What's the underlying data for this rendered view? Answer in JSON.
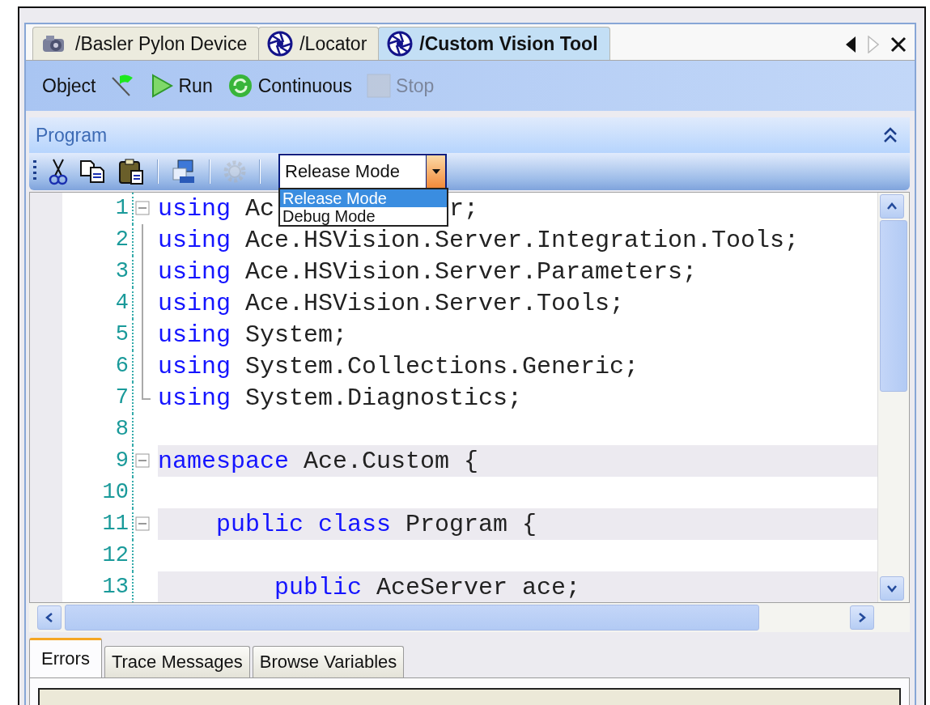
{
  "tabs": [
    {
      "label": "/Basler Pylon Device",
      "kind": "camera",
      "selected": false
    },
    {
      "label": "/Locator",
      "kind": "aperture",
      "selected": false
    },
    {
      "label": "/Custom Vision Tool",
      "kind": "aperture",
      "selected": true
    }
  ],
  "toolbar": [
    {
      "kind": "text",
      "label": "Object",
      "disabled": false
    },
    {
      "kind": "flag",
      "disabled": false
    },
    {
      "kind": "run",
      "label": "Run",
      "disabled": false
    },
    {
      "kind": "continuous",
      "label": "Continuous",
      "disabled": false
    },
    {
      "kind": "stop",
      "label": "Stop",
      "disabled": true
    }
  ],
  "section": {
    "title": "Program",
    "expanded": true
  },
  "edit_toolbar": {
    "tools": [
      {
        "kind": "cut",
        "disabled": false
      },
      {
        "kind": "copy",
        "disabled": false
      },
      {
        "kind": "paste",
        "disabled": false
      },
      {
        "kind": "separator"
      },
      {
        "kind": "deploy",
        "disabled": false
      },
      {
        "kind": "separator"
      },
      {
        "kind": "settings",
        "disabled": true
      },
      {
        "kind": "separator"
      }
    ],
    "mode_select": {
      "value": "Release Mode",
      "expanded": true,
      "options": [
        {
          "label": "Release Mode",
          "selected": true
        },
        {
          "label": "Debug Mode",
          "selected": false
        }
      ]
    }
  },
  "editor": {
    "lines": [
      {
        "number": "1",
        "kind": "fold_start",
        "highlighted": false,
        "tokens": [
          {
            "kind": "keyword",
            "text": "using"
          },
          {
            "kind": "plain",
            "text": "Ac"
          },
          {
            "kind": "covered"
          },
          {
            "kind": "plain",
            "text": "r;"
          }
        ]
      },
      {
        "number": "2",
        "kind": "fold_inner",
        "highlighted": false,
        "tokens": [
          {
            "kind": "keyword",
            "text": "using"
          },
          {
            "kind": "plain",
            "text": "Ace.HSVision.Server.Integration.Tools;"
          }
        ]
      },
      {
        "number": "3",
        "kind": "fold_inner",
        "highlighted": false,
        "tokens": [
          {
            "kind": "keyword",
            "text": "using"
          },
          {
            "kind": "plain",
            "text": "Ace.HSVision.Server.Parameters;"
          }
        ]
      },
      {
        "number": "4",
        "kind": "fold_inner",
        "highlighted": false,
        "tokens": [
          {
            "kind": "keyword",
            "text": "using"
          },
          {
            "kind": "plain",
            "text": "Ace.HSVision.Server.Tools;"
          }
        ]
      },
      {
        "number": "5",
        "kind": "fold_inner",
        "highlighted": false,
        "tokens": [
          {
            "kind": "keyword",
            "text": "using"
          },
          {
            "kind": "plain",
            "text": "System;"
          }
        ]
      },
      {
        "number": "6",
        "kind": "fold_inner",
        "highlighted": false,
        "tokens": [
          {
            "kind": "keyword",
            "text": "using"
          },
          {
            "kind": "plain",
            "text": "System.Collections.Generic;"
          }
        ]
      },
      {
        "number": "7",
        "kind": "fold_end",
        "highlighted": false,
        "tokens": [
          {
            "kind": "keyword",
            "text": "using"
          },
          {
            "kind": "plain",
            "text": "System.Diagnostics;"
          }
        ]
      },
      {
        "number": "8",
        "kind": "plain",
        "highlighted": false
      },
      {
        "number": "9",
        "kind": "fold_start",
        "highlighted": true,
        "tokens": [
          {
            "kind": "keyword",
            "text": "namespace"
          },
          {
            "kind": "plain",
            "text": "Ace.Custom {"
          }
        ]
      },
      {
        "number": "10",
        "kind": "plain",
        "highlighted": false
      },
      {
        "number": "11",
        "kind": "fold_start",
        "highlighted": true,
        "tokens": [
          {
            "kind": "keyword",
            "text": "    public class"
          },
          {
            "kind": "plain",
            "text": "Program {"
          }
        ]
      },
      {
        "number": "12",
        "kind": "plain",
        "highlighted": false
      },
      {
        "number": "13",
        "kind": "plain",
        "highlighted": true,
        "tokens": [
          {
            "kind": "keyword",
            "text": "        public"
          },
          {
            "kind": "plain",
            "text": "AceServer ace;"
          }
        ]
      }
    ]
  },
  "bottom_tabs": [
    {
      "label": "Errors",
      "selected": true
    },
    {
      "label": "Trace Messages",
      "selected": false
    },
    {
      "label": "Browse Variables",
      "selected": false
    }
  ]
}
